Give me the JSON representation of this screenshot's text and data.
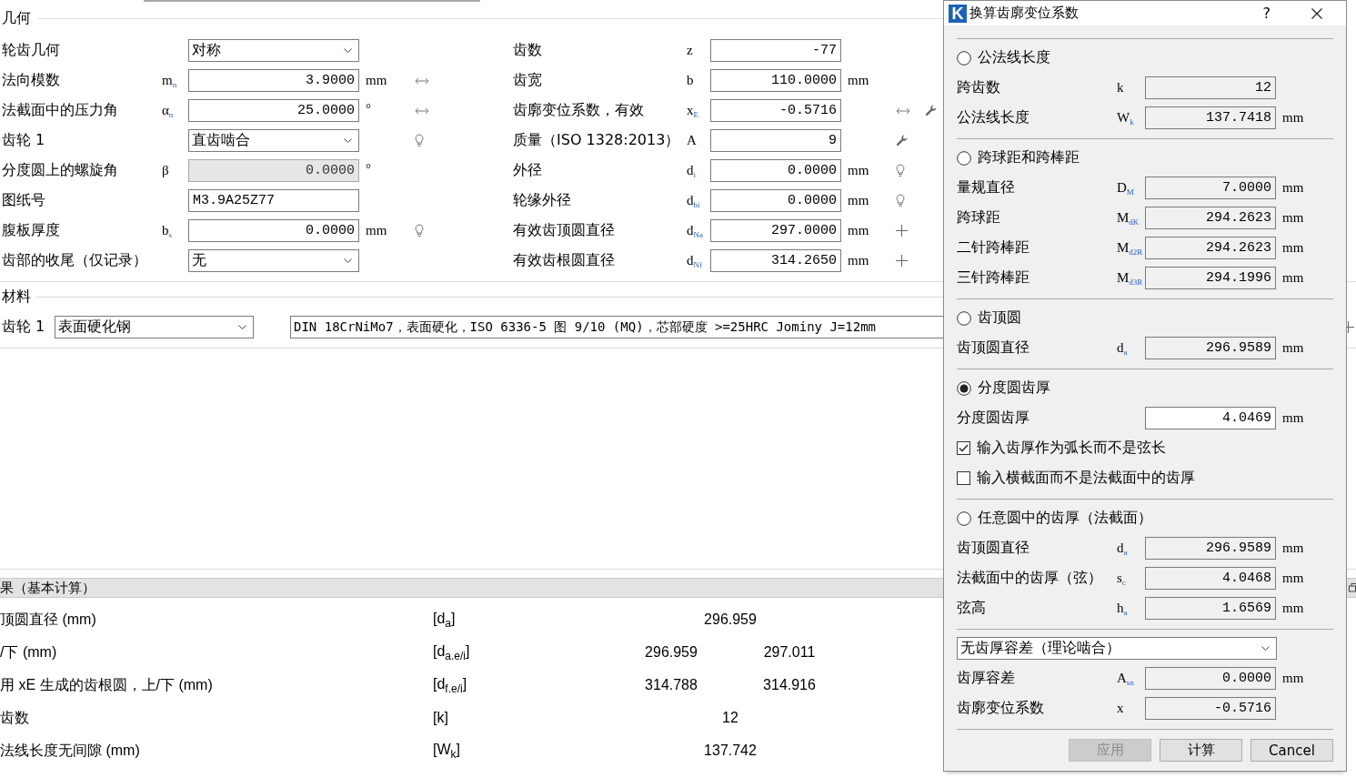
{
  "geometry": {
    "title": "几何",
    "left": [
      {
        "label": "轮齿几何",
        "kind": "combo",
        "value": "对称",
        "disabled": false
      },
      {
        "label": "法向模数",
        "symbol": "m$_{n}$",
        "kind": "number",
        "value": "3.9000",
        "unit": "mm",
        "disabled": false,
        "tools": [
          {
            "kind": "swap"
          }
        ]
      },
      {
        "label": "法截面中的压力角",
        "symbol": "α$_{n}$",
        "kind": "number",
        "value": "25.0000",
        "unit": "°",
        "disabled": false,
        "tools": [
          {
            "kind": "swap"
          }
        ]
      },
      {
        "label": "齿轮 1",
        "kind": "combo",
        "value": "直齿啮合",
        "disabled": false,
        "tools": [
          {
            "kind": "hint"
          }
        ]
      },
      {
        "label": "分度圆上的螺旋角",
        "symbol": "β",
        "kind": "number",
        "value": "0.0000",
        "unit": "°",
        "disabled": true
      },
      {
        "label": "图纸号",
        "kind": "text",
        "value": "M3.9A25Z77",
        "disabled": false
      },
      {
        "label": "腹板厚度",
        "symbol": "b$_{s}$",
        "kind": "number",
        "value": "0.0000",
        "unit": "mm",
        "disabled": false,
        "tools": [
          {
            "kind": "hint"
          }
        ]
      },
      {
        "label": "齿部的收尾（仅记录）",
        "kind": "combo",
        "value": "无",
        "disabled": false
      }
    ],
    "right": [
      {
        "label": "齿数",
        "symbol": "z",
        "kind": "number",
        "value": "-77",
        "disabled": false
      },
      {
        "label": "齿宽",
        "symbol": "b",
        "kind": "number",
        "value": "110.0000",
        "unit": "mm",
        "disabled": false
      },
      {
        "label": "齿廓变位系数，有效",
        "symbol": "x$_{E}$",
        "kind": "number",
        "value": "-0.5716",
        "disabled": false,
        "tools": [
          {
            "kind": "swap"
          },
          {
            "kind": "wrench"
          }
        ]
      },
      {
        "label": "质量（ISO 1328:2013）",
        "symbol": "A",
        "kind": "number",
        "value": "9",
        "disabled": false,
        "tools": [
          {
            "kind": "wrench"
          }
        ]
      },
      {
        "label": "外径",
        "symbol": "d$_{i}$",
        "kind": "number",
        "value": "0.0000",
        "unit": "mm",
        "disabled": false,
        "tools": [
          {
            "kind": "hint"
          }
        ]
      },
      {
        "label": "轮缘外径",
        "symbol": "d$_{bi}$",
        "kind": "number",
        "value": "0.0000",
        "unit": "mm",
        "disabled": false,
        "tools": [
          {
            "kind": "hint"
          }
        ]
      },
      {
        "label": "有效齿顶圆直径",
        "symbol": "d$_{Na}$",
        "kind": "number",
        "value": "297.0000",
        "unit": "mm",
        "disabled": false,
        "tools": [
          {
            "kind": "add"
          }
        ]
      },
      {
        "label": "有效齿根圆直径",
        "symbol": "d$_{Nf}$",
        "kind": "number",
        "value": "314.2650",
        "unit": "mm",
        "disabled": false,
        "tools": [
          {
            "kind": "add"
          }
        ]
      }
    ]
  },
  "material": {
    "title": "材料",
    "label": "齿轮 1",
    "type": "表面硬化钢",
    "description": "DIN 18CrNiMo7，表面硬化，ISO 6336-5 图 9/10 (MQ)，芯部硬度 >=25HRC Jominy J=12mm"
  },
  "results": {
    "title": "果（基本计算）",
    "rows": [
      {
        "label": "顶圆直径 (mm)",
        "symbol": "[d$_{a}$]",
        "values": [
          "296.959"
        ]
      },
      {
        "label": "/下 (mm)",
        "symbol": "[d$_{a.e/i}$]",
        "values": [
          "296.959",
          "297.011"
        ]
      },
      {
        "label": "用 xE 生成的齿根圆，上/下 (mm)",
        "symbol": "[d$_{f.e/i}$]",
        "values": [
          "314.788",
          "314.916"
        ]
      },
      {
        "label": "齿数",
        "symbol": "[k]",
        "values": [
          "12"
        ]
      },
      {
        "label": "法线长度无间隙 (mm)",
        "symbol": "[W$_{k}$]",
        "values": [
          "137.742"
        ]
      }
    ]
  },
  "dialog": {
    "logo": "K",
    "title": "换算齿廓变位系数",
    "help": "?",
    "sections": [
      {
        "option": {
          "label": "公法线长度",
          "selected": false
        },
        "rows": [
          {
            "kind": "field",
            "label": "跨齿数",
            "symbol": "k",
            "value": "12",
            "readonly": true
          },
          {
            "kind": "field",
            "label": "公法线长度",
            "symbol": "W$_{k}$",
            "value": "137.7418",
            "unit": "mm",
            "readonly": true
          }
        ]
      },
      {
        "option": {
          "label": "跨球距和跨棒距",
          "selected": false
        },
        "rows": [
          {
            "kind": "field",
            "label": "量规直径",
            "symbol": "D$_{M}$",
            "value": "7.0000",
            "unit": "mm",
            "readonly": true
          },
          {
            "kind": "field",
            "label": "跨球距",
            "symbol": "M$_{dK}$",
            "value": "294.2623",
            "unit": "mm",
            "readonly": true
          },
          {
            "kind": "field",
            "label": "二针跨棒距",
            "symbol": "M$_{d2R}$",
            "value": "294.2623",
            "unit": "mm",
            "readonly": true
          },
          {
            "kind": "field",
            "label": "三针跨棒距",
            "symbol": "M$_{d3R}$",
            "value": "294.1996",
            "unit": "mm",
            "readonly": true
          }
        ]
      },
      {
        "option": {
          "label": "齿顶圆",
          "selected": false
        },
        "rows": [
          {
            "kind": "field",
            "label": "齿顶圆直径",
            "symbol": "d$_{a}$",
            "value": "296.9589",
            "unit": "mm",
            "readonly": true
          }
        ]
      },
      {
        "option": {
          "label": "分度圆齿厚",
          "selected": true
        },
        "rows": [
          {
            "kind": "field",
            "label": "分度圆齿厚",
            "value": "4.0469",
            "unit": "mm",
            "readonly": false
          },
          {
            "kind": "checkbox",
            "label": "输入齿厚作为弧长而不是弦长",
            "checked": true
          },
          {
            "kind": "checkbox",
            "label": "输入横截面而不是法截面中的齿厚",
            "checked": false
          }
        ]
      },
      {
        "option": {
          "label": "任意圆中的齿厚（法截面）",
          "selected": false
        },
        "rows": [
          {
            "kind": "field",
            "label": "齿顶圆直径",
            "symbol": "d$_{a}$",
            "value": "296.9589",
            "unit": "mm",
            "readonly": true
          },
          {
            "kind": "field",
            "label": "法截面中的齿厚（弦）",
            "symbol": "s$_{c}$",
            "value": "4.0468",
            "unit": "mm",
            "readonly": true
          },
          {
            "kind": "field",
            "label": "弦高",
            "symbol": "h$_{a}$",
            "value": "1.6569",
            "unit": "mm",
            "readonly": true
          }
        ]
      },
      {
        "rows": [
          {
            "kind": "combo",
            "value": "无齿厚容差（理论啮合）"
          },
          {
            "kind": "field",
            "label": "齿厚容差",
            "symbol": "A$_{sn}$",
            "value": "0.0000",
            "unit": "mm",
            "readonly": true
          },
          {
            "kind": "field",
            "label": "齿廓变位系数",
            "symbol": "x",
            "value": "-0.5716",
            "readonly": true
          }
        ]
      }
    ],
    "buttons": [
      {
        "label": "应用",
        "disabled": true
      },
      {
        "label": "计算",
        "disabled": false
      },
      {
        "label": "Cancel",
        "disabled": false
      }
    ]
  }
}
